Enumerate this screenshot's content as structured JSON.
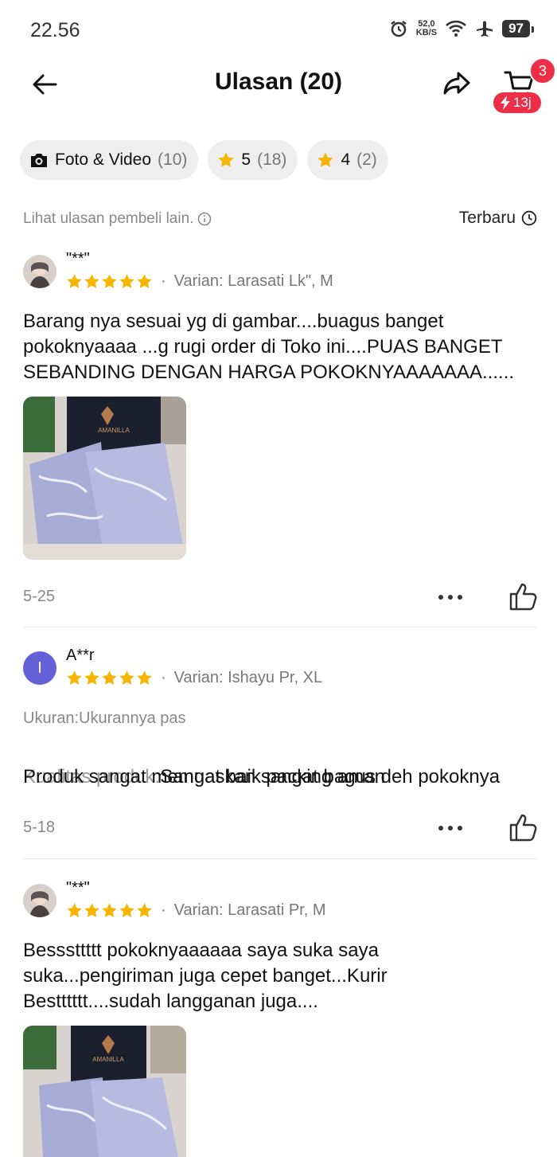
{
  "status": {
    "time": "22.56",
    "speed_value": "52,0",
    "speed_unit": "KB/S",
    "battery": "97"
  },
  "header": {
    "title": "Ulasan (20)",
    "cart_count": "3",
    "flash_label": "13j"
  },
  "filters": [
    {
      "label": "Foto & Video",
      "count": "(10)",
      "icon": "camera-icon"
    },
    {
      "label": "5",
      "count": "(18)",
      "icon": "star-icon"
    },
    {
      "label": "4",
      "count": "(2)",
      "icon": "star-icon"
    }
  ],
  "subbar": {
    "hint": "Lihat ulasan pembeli lain.",
    "sort": "Terbaru"
  },
  "reviews": [
    {
      "user": "\"**\"",
      "stars": 5,
      "variant": "Varian: Larasati Lk\", M",
      "text": "Barang nya sesuai yg di gambar....buagus banget\npokoknyaaaa ...g rugi order di Toko ini....PUAS BANGET\nSEBANDING DENGAN HARGA POKOKNYAAAAAAA......",
      "has_photo": true,
      "brand_on_photo": "AMANILLA",
      "date": "5-25"
    },
    {
      "user": "A**r",
      "avatar_letter": "I",
      "stars": 5,
      "variant": "Varian: Ishayu Pr, XL",
      "size_line": "Ukuran:Ukurannya pas",
      "quality_label": "Kualitas produk:",
      "quality_text": "Sangat baik packing aman",
      "text2": "Produk sangat memuaskan sangat bagus deh pokoknya",
      "date": "5-18"
    },
    {
      "user": "\"**\"",
      "stars": 5,
      "variant": "Varian: Larasati Pr, M",
      "text": "Besssttttt pokoknyaaaaaa saya suka saya\nsuka...pengiriman juga cepet banget...Kurir\nBestttttt....sudah langganan juga....",
      "has_photo": true,
      "brand_on_photo": "AMANILLA"
    }
  ],
  "colors": {
    "star": "#f7b500",
    "badge": "#ee2e46",
    "avatar_purple": "#6360d8"
  }
}
